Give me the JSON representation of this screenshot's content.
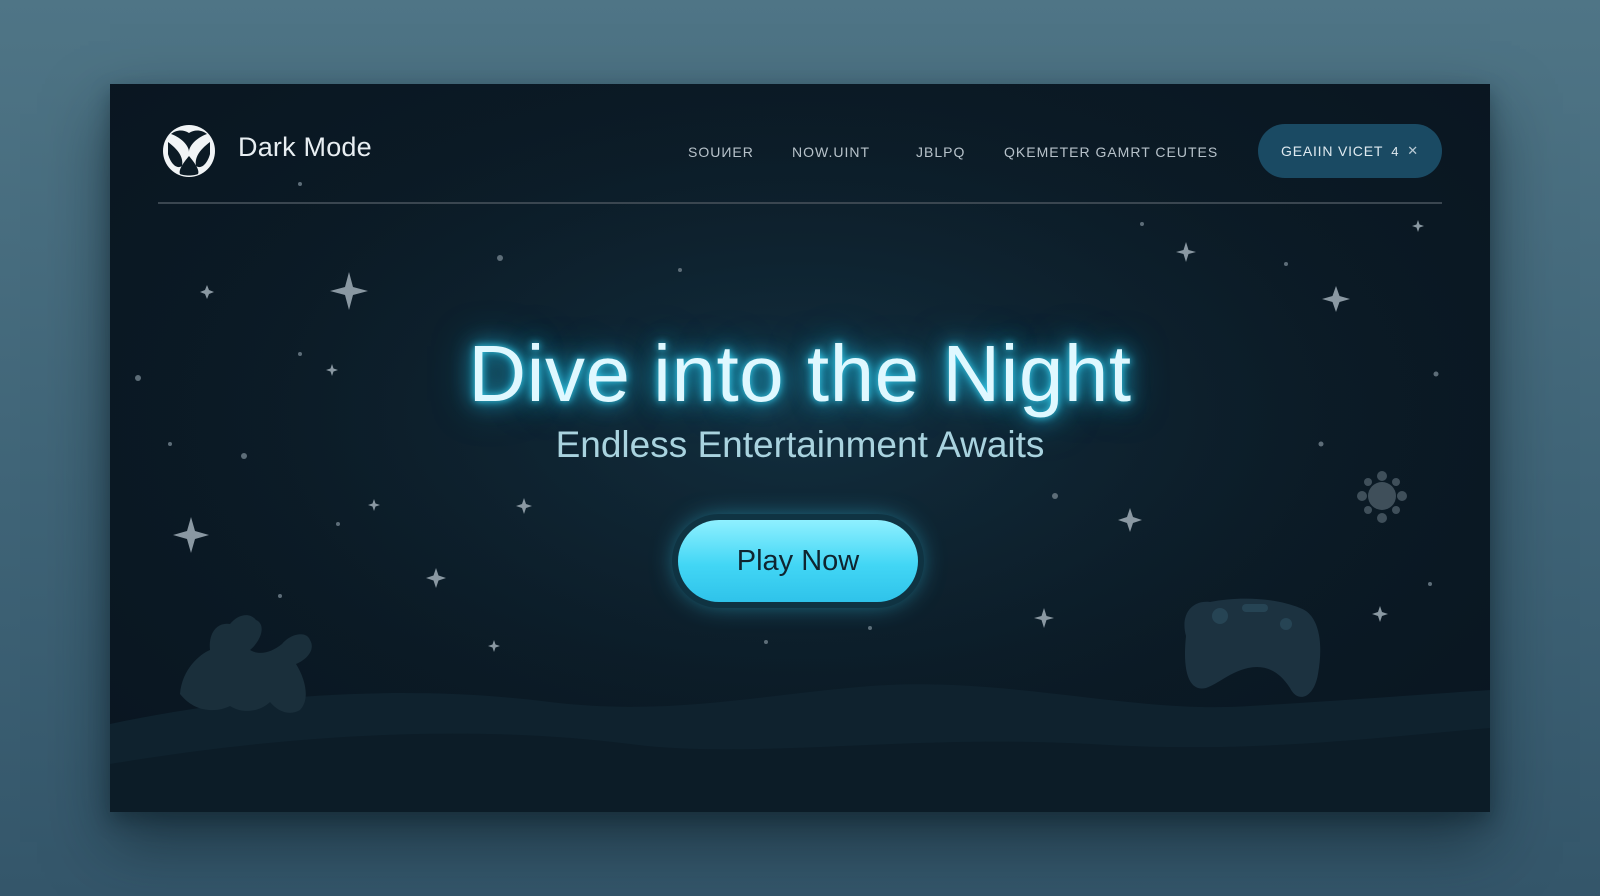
{
  "header": {
    "brand": "Dark Mode",
    "logo_icon": "xbox-logo-icon",
    "nav": [
      "SOUИER",
      "NOW.UINT",
      "JBLPQ",
      "QKEMETER GAMRT CEUTES"
    ],
    "cta_label": "GEAIIN VICET",
    "cta_count": "4",
    "cta_close_icon": "close-icon"
  },
  "hero": {
    "title": "Dive into the Night",
    "subtitle": "Endless Entertainment Awaits",
    "button": "Play Now"
  },
  "colors": {
    "page_bg": "#4f7586",
    "panel_bg": "#0b1a25",
    "accent": "#42d6f5",
    "cta_bg": "#1a4a63"
  },
  "decor_icons": [
    "sparkle-star-icon",
    "game-controller-icon",
    "creature-silhouette-icon",
    "flower-icon"
  ]
}
